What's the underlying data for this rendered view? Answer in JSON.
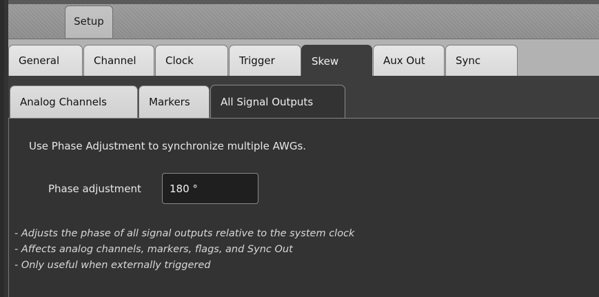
{
  "top_tabs": {
    "setup_label": "Setup"
  },
  "main_tabs": [
    {
      "label": "General",
      "active": false
    },
    {
      "label": "Channel",
      "active": false
    },
    {
      "label": "Clock",
      "active": false
    },
    {
      "label": "Trigger",
      "active": false
    },
    {
      "label": "Skew",
      "active": true
    },
    {
      "label": "Aux Out",
      "active": false
    },
    {
      "label": "Sync",
      "active": false
    }
  ],
  "sub_tabs": [
    {
      "label": "Analog Channels",
      "active": false
    },
    {
      "label": "Markers",
      "active": false
    },
    {
      "label": "All Signal Outputs",
      "active": true
    }
  ],
  "content": {
    "intro": "Use Phase Adjustment to synchronize multiple AWGs.",
    "phase_label": "Phase adjustment",
    "phase_value": "180 °",
    "notes": [
      "- Adjusts the phase of all signal outputs relative to the system clock",
      "- Affects analog channels, markers, flags, and Sync Out",
      "- Only useful when externally triggered"
    ]
  },
  "colors": {
    "panel_bg": "#333333",
    "tab_inactive_bg": "#dcdcdc",
    "tab_active_bg": "#3d3d3d",
    "text_light": "#e8e8e8"
  }
}
